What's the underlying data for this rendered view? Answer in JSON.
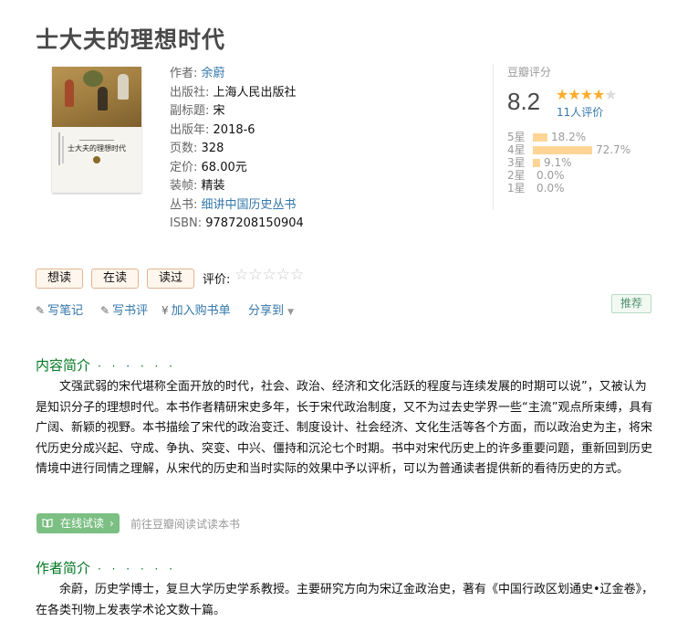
{
  "book": {
    "title": "士大夫的理想时代",
    "cover": {
      "small_text": "余蔚",
      "title_text": "士大夫的理想时代"
    }
  },
  "info": [
    {
      "label": "作者:",
      "value": "余蔚",
      "link": true
    },
    {
      "label": "出版社:",
      "value": "上海人民出版社",
      "link": false
    },
    {
      "label": "副标题:",
      "value": "宋",
      "link": false
    },
    {
      "label": "出版年:",
      "value": "2018-6",
      "link": false
    },
    {
      "label": "页数:",
      "value": "328",
      "link": false
    },
    {
      "label": "定价:",
      "value": "68.00元",
      "link": false
    },
    {
      "label": "装帧:",
      "value": "精装",
      "link": false
    },
    {
      "label": "丛书:",
      "value": "细讲中国历史丛书",
      "link": true
    },
    {
      "label": "ISBN:",
      "value": "9787208150904",
      "link": false
    }
  ],
  "rating": {
    "heading": "豆瓣评分",
    "score": "8.2",
    "stars_filled": 4,
    "stars_total": 5,
    "people": "11人评价",
    "breakdown": [
      {
        "label": "5星",
        "percent": 18.2,
        "text": "18.2%"
      },
      {
        "label": "4星",
        "percent": 72.7,
        "text": "72.7%"
      },
      {
        "label": "3星",
        "percent": 9.1,
        "text": "9.1%"
      },
      {
        "label": "2星",
        "percent": 0.0,
        "text": "0.0%"
      },
      {
        "label": "1星",
        "percent": 0.0,
        "text": "0.0%"
      }
    ]
  },
  "actions": {
    "want": "想读",
    "reading": "在读",
    "read": "读过",
    "rate_label": "评价:",
    "rate_stars": "☆☆☆☆☆"
  },
  "links": {
    "note": "写笔记",
    "review": "写书评",
    "cart": "加入购书单",
    "share": "分享到",
    "recommend": "推荐"
  },
  "intro": {
    "title": "内容简介",
    "dots": "· · · · · ·",
    "text": "文强武弱的宋代堪称全面开放的时代，社会、政治、经济和文化活跃的程度与连续发展的时期可以说”，又被认为是知识分子的理想时代。本书作者精研宋史多年，长于宋代政治制度，又不为过去史学界一些“主流”观点所束缚，具有广阔、新颖的视野。本书描绘了宋代的政治变迁、制度设计、社会经济、文化生活等各个方面，而以政治史为主，将宋代历史分成兴起、守成、争执、突变、中兴、僵持和沉沦七个时期。书中对宋代历史上的许多重要问题，重新回到历史情境中进行同情之理解，从宋代的历史和当时实际的效果中予以评析，可以为普通读者提供新的看待历史的方式。"
  },
  "read_online": {
    "button": "在线试读",
    "tip": "前往豆瓣阅读试读本书"
  },
  "author": {
    "title": "作者简介",
    "dots": "· · · · · ·",
    "text": "余蔚，历史学博士，复旦大学历史学系教授。主要研究方向为宋辽金政治史，著有《中国行政区划通史•辽金卷》，在各类刊物上发表学术论文数十篇。"
  },
  "colors": {
    "link": "#3377aa",
    "section_green": "#007722",
    "star": "#ffac2d",
    "bar": "#ffd596"
  }
}
